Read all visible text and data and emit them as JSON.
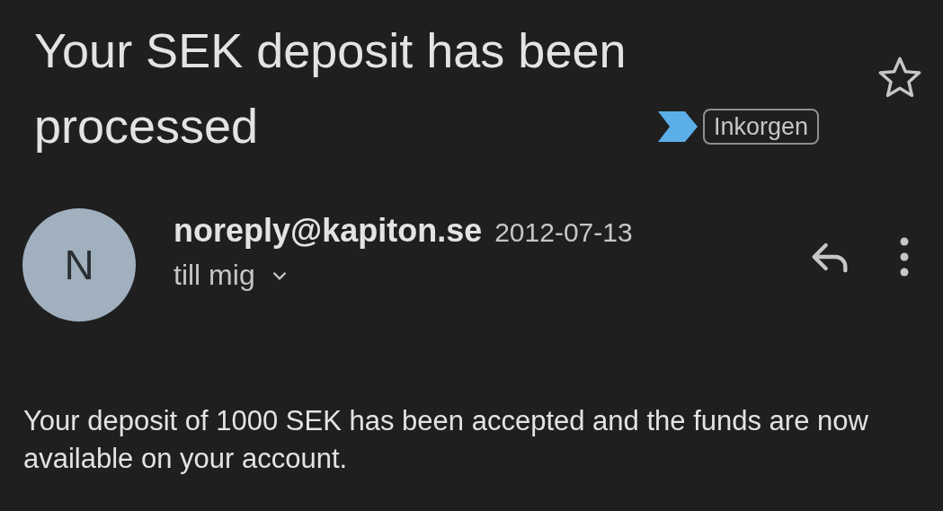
{
  "email": {
    "subject": "Your SEK deposit has been processed",
    "important": true,
    "label": "Inkorgen",
    "starred": false,
    "sender": {
      "initial": "N",
      "address": "noreply@kapiton.se",
      "date": "2012-07-13",
      "recipient": "till mig"
    },
    "body": "Your deposit of 1000 SEK has been accepted and the funds are now available on your account."
  }
}
